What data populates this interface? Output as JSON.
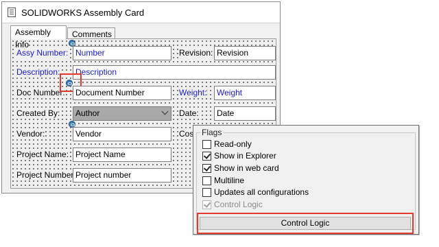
{
  "window": {
    "title": "SOLIDWORKS Assembly Card",
    "icon": "card-icon"
  },
  "tabs": [
    {
      "label": "Assembly Info",
      "active": true
    },
    {
      "label": "Comments",
      "active": false
    }
  ],
  "form": {
    "assy_number": {
      "label": "Assy Number:",
      "value": "Number"
    },
    "revision": {
      "label": "Revision:",
      "value": "Revision"
    },
    "description": {
      "label": "Description:",
      "value": "Description"
    },
    "doc_number": {
      "label": "Doc Number:",
      "value": "Document Number"
    },
    "weight": {
      "label": "Weight:",
      "value": "Weight"
    },
    "created_by": {
      "label": "Created By:",
      "value": "Author"
    },
    "date": {
      "label": "Date:",
      "value": "Date"
    },
    "vendor": {
      "label": "Vendor:",
      "value": "Vendor"
    },
    "cost": {
      "label": "Cos"
    },
    "project_name": {
      "label": "Project Name:",
      "value": "Project Name"
    },
    "project_number": {
      "label": "Project Number:",
      "value": "Project number"
    }
  },
  "flags": {
    "title": "Flags",
    "items": [
      {
        "label": "Read-only",
        "checked": false,
        "disabled": false
      },
      {
        "label": "Show in Explorer",
        "checked": true,
        "disabled": false
      },
      {
        "label": "Show in web card",
        "checked": true,
        "disabled": false
      },
      {
        "label": "Multiline",
        "checked": false,
        "disabled": false
      },
      {
        "label": "Updates all configurations",
        "checked": false,
        "disabled": false
      },
      {
        "label": "Control Logic",
        "checked": true,
        "disabled": true
      }
    ],
    "button_label": "Control Logic"
  },
  "colors": {
    "highlight": "#e23a2e",
    "label_blue": "#1a1ad6",
    "link_icon": "#3c79b8"
  }
}
